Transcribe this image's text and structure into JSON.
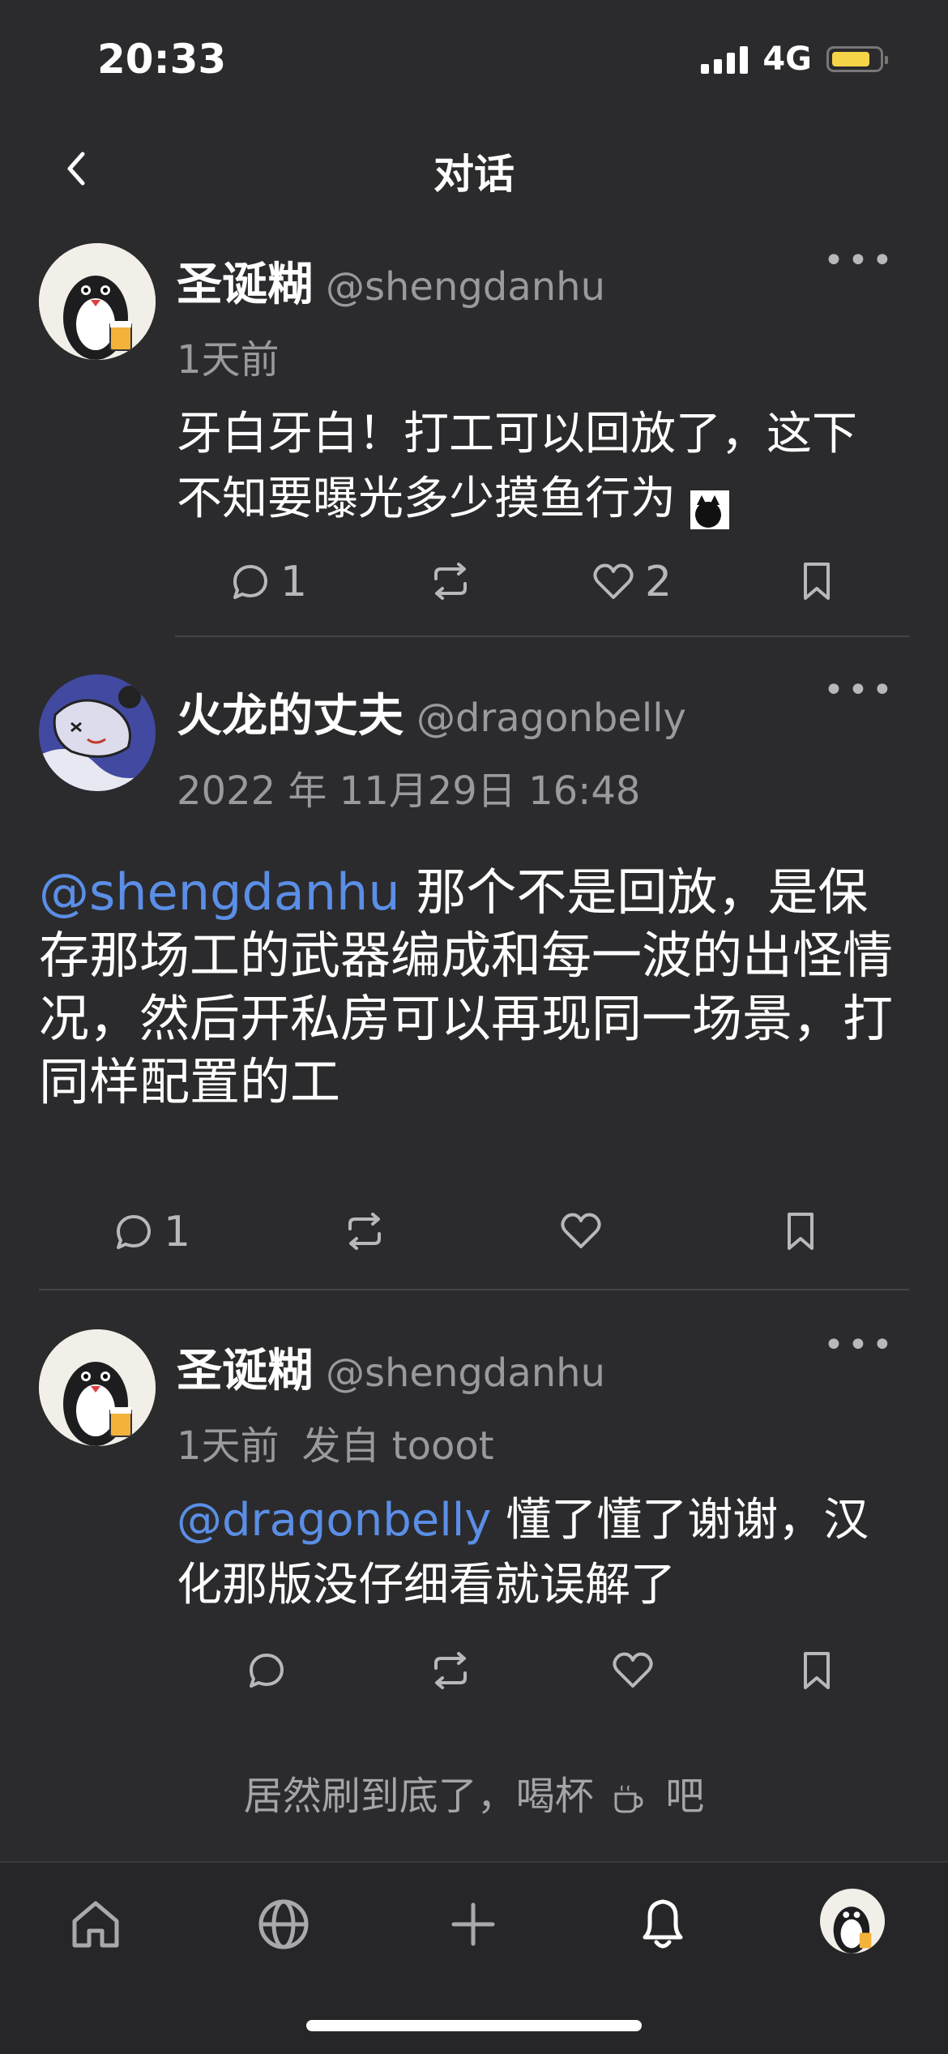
{
  "status_bar": {
    "time": "20:33",
    "network": "4G"
  },
  "header": {
    "title": "对话"
  },
  "posts": [
    {
      "name": "圣诞糊",
      "handle": "@shengdanhu",
      "meta": "1天前",
      "body": "牙白牙白！打工可以回放了，这下不知要曝光多少摸鱼行为",
      "replies": "1",
      "favourites": "2"
    },
    {
      "name": "火龙的丈夫",
      "handle": "@dragonbelly",
      "meta": "2022 年 11月29日 16:48",
      "mention": "@shengdanhu",
      "body": " 那个不是回放，是保存那场工的武器编成和每一波的出怪情况，然后开私房可以再现同一场景，打同样配置的工",
      "replies": "1"
    },
    {
      "name": "圣诞糊",
      "handle": "@shengdanhu",
      "meta": "1天前",
      "meta_source": "发自 tooot",
      "mention": "@dragonbelly",
      "body": " 懂了懂了谢谢，汉化那版没仔细看就误解了"
    }
  ],
  "footer": {
    "note_before": "居然刷到底了，喝杯",
    "note_after": "吧"
  },
  "icons": [
    "back-icon",
    "more-icon",
    "reply-icon",
    "boost-icon",
    "favourite-icon",
    "bookmark-icon",
    "home-icon",
    "globe-icon",
    "compose-icon",
    "notifications-icon",
    "profile-avatar"
  ],
  "colors": {
    "background": "#2b2b2d",
    "mention": "#5b8ee6",
    "secondary_text": "#9a9a9c",
    "battery": "#f5d547"
  }
}
